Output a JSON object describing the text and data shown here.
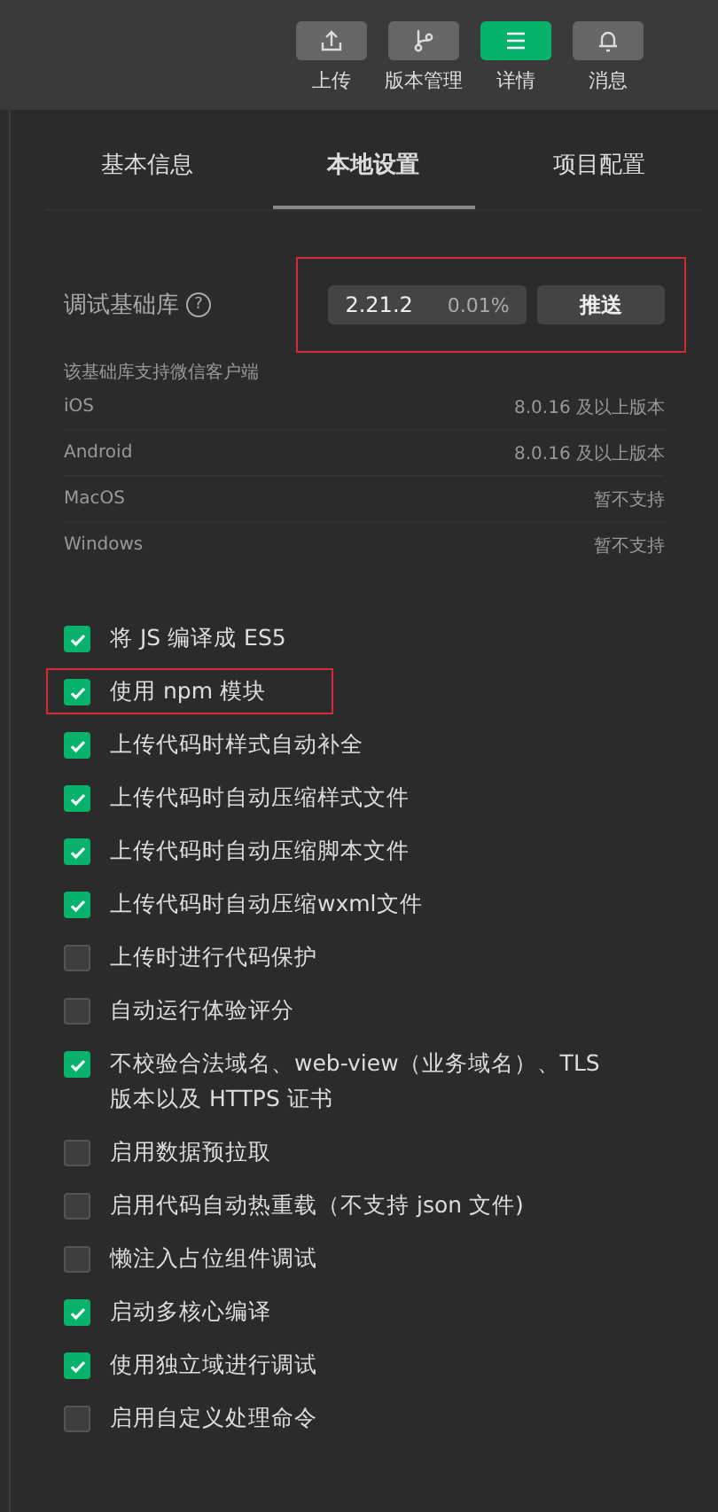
{
  "toolbar": [
    {
      "kind": "upload",
      "label": "上传",
      "selected": false
    },
    {
      "kind": "branch",
      "label": "版本管理",
      "selected": false
    },
    {
      "kind": "menu",
      "label": "详情",
      "selected": true
    },
    {
      "kind": "bell",
      "label": "消息",
      "selected": false
    }
  ],
  "tabs": [
    {
      "label": "基本信息",
      "selected": false
    },
    {
      "label": "本地设置",
      "selected": true
    },
    {
      "label": "项目配置",
      "selected": false
    }
  ],
  "library": {
    "label": "调试基础库",
    "help": "?",
    "version": "2.21.2",
    "share": "0.01%",
    "button": "推送",
    "highlighted": true
  },
  "support": {
    "title": "该基础库支持微信客户端",
    "rows": [
      {
        "platform": "iOS",
        "value": "8.0.16 及以上版本"
      },
      {
        "platform": "Android",
        "value": "8.0.16 及以上版本"
      },
      {
        "platform": "MacOS",
        "value": "暂不支持"
      },
      {
        "platform": "Windows",
        "value": "暂不支持"
      }
    ]
  },
  "options": [
    {
      "label": "将 JS 编译成 ES5",
      "checked": true,
      "highlighted": false
    },
    {
      "label": "使用 npm 模块",
      "checked": true,
      "highlighted": true
    },
    {
      "label": "上传代码时样式自动补全",
      "checked": true,
      "highlighted": false
    },
    {
      "label": "上传代码时自动压缩样式文件",
      "checked": true,
      "highlighted": false
    },
    {
      "label": "上传代码时自动压缩脚本文件",
      "checked": true,
      "highlighted": false
    },
    {
      "label": "上传代码时自动压缩wxml文件",
      "checked": true,
      "highlighted": false
    },
    {
      "label": "上传时进行代码保护",
      "checked": false,
      "highlighted": false
    },
    {
      "label": "自动运行体验评分",
      "checked": false,
      "highlighted": false
    },
    {
      "label": "不校验合法域名、web-view（业务域名）、TLS 版本以及 HTTPS 证书",
      "checked": true,
      "highlighted": false
    },
    {
      "label": "启用数据预拉取",
      "checked": false,
      "highlighted": false
    },
    {
      "label": "启用代码自动热重载（不支持 json 文件)",
      "checked": false,
      "highlighted": false
    },
    {
      "label": "懒注入占位组件调试",
      "checked": false,
      "highlighted": false
    },
    {
      "label": "启动多核心编译",
      "checked": true,
      "highlighted": false
    },
    {
      "label": "使用独立域进行调试",
      "checked": true,
      "highlighted": false
    },
    {
      "label": "启用自定义处理命令",
      "checked": false,
      "highlighted": false
    }
  ]
}
